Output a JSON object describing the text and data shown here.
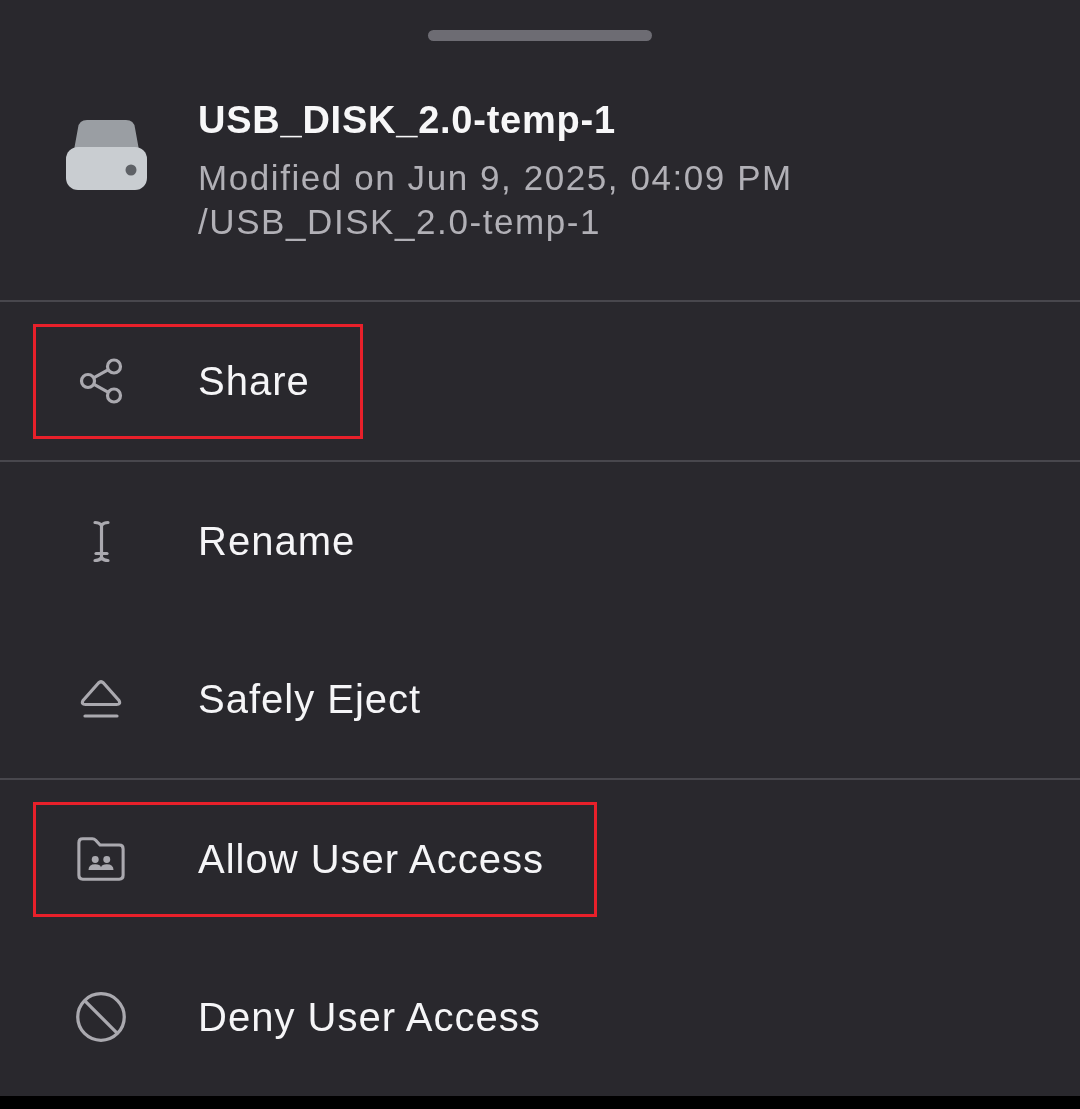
{
  "header": {
    "title": "USB_DISK_2.0-temp-1",
    "modified": "Modified on Jun 9, 2025, 04:09 PM",
    "path": "/USB_DISK_2.0-temp-1"
  },
  "sections": [
    {
      "items": [
        {
          "kind": "share",
          "label": "Share",
          "highlighted": true
        }
      ]
    },
    {
      "items": [
        {
          "kind": "rename",
          "label": "Rename",
          "highlighted": false
        },
        {
          "kind": "eject",
          "label": "Safely Eject",
          "highlighted": false
        }
      ]
    },
    {
      "items": [
        {
          "kind": "allow-access",
          "label": "Allow User Access",
          "highlighted": true
        },
        {
          "kind": "deny-access",
          "label": "Deny User Access",
          "highlighted": false
        }
      ]
    }
  ]
}
